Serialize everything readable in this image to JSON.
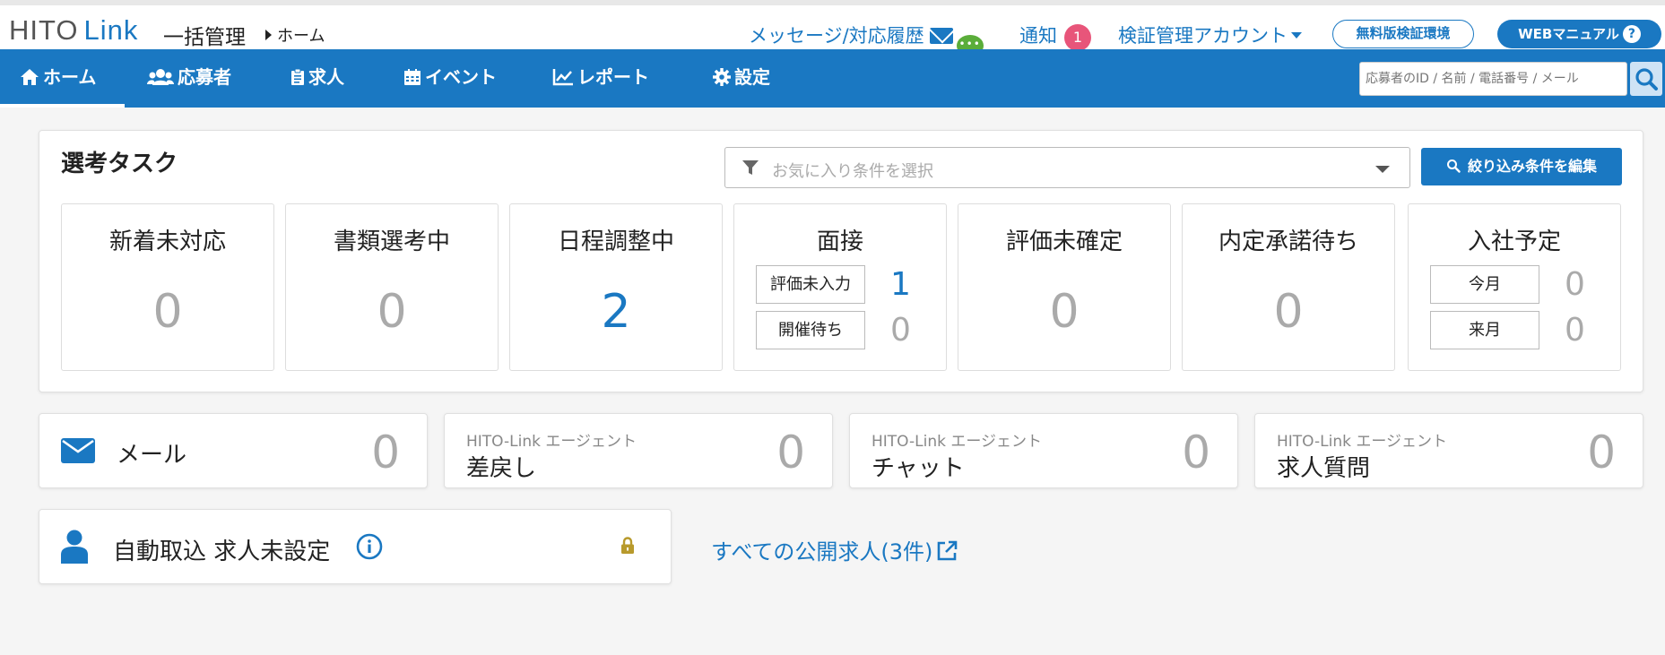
{
  "header": {
    "logo_main": "HITO",
    "logo_sub": "Link",
    "app_title": "一括管理",
    "breadcrumb": "ホーム",
    "messages_label": "メッセージ/対応履歴",
    "notify_label": "通知",
    "notify_count": "1",
    "account_label": "検証管理アカウント",
    "free_env_label": "無料版検証環境",
    "manual_label": "WEBマニュアル",
    "manual_q": "?"
  },
  "nav": {
    "items": [
      {
        "label": "ホーム",
        "icon": "home-icon"
      },
      {
        "label": "応募者",
        "icon": "users-icon"
      },
      {
        "label": "求人",
        "icon": "clipboard-icon"
      },
      {
        "label": "イベント",
        "icon": "calendar-icon"
      },
      {
        "label": "レポート",
        "icon": "chart-line-icon"
      },
      {
        "label": "設定",
        "icon": "gear-icon"
      }
    ],
    "search_placeholder": "応募者のID / 名前 / 電話番号 / メール"
  },
  "task": {
    "title": "選考タスク",
    "filter_placeholder": "お気に入り条件を選択",
    "filter_button": "絞り込み条件を編集",
    "stats": [
      {
        "label": "新着未対応",
        "value": "0"
      },
      {
        "label": "書類選考中",
        "value": "0"
      },
      {
        "label": "日程調整中",
        "value": "2"
      },
      {
        "label": "面接",
        "sub": [
          {
            "label": "評価未入力",
            "value": "1"
          },
          {
            "label": "開催待ち",
            "value": "0"
          }
        ]
      },
      {
        "label": "評価未確定",
        "value": "0"
      },
      {
        "label": "内定承諾待ち",
        "value": "0"
      },
      {
        "label": "入社予定",
        "sub": [
          {
            "label": "今月",
            "value": "0"
          },
          {
            "label": "来月",
            "value": "0"
          }
        ]
      }
    ]
  },
  "cards": {
    "mail": {
      "label": "メール",
      "count": "0"
    },
    "remand": {
      "tag": "HITO-Link エージェント",
      "label": "差戻し",
      "count": "0"
    },
    "chat": {
      "tag": "HITO-Link エージェント",
      "label": "チャット",
      "count": "0"
    },
    "question": {
      "tag": "HITO-Link エージェント",
      "label": "求人質問",
      "count": "0"
    }
  },
  "auto": {
    "label": "自動取込 求人未設定",
    "all_jobs_link": "すべての公開求人(3件)"
  },
  "colors": {
    "brand": "#1a78c2",
    "badge": "#e8557a",
    "lock": "#b89a2c"
  }
}
